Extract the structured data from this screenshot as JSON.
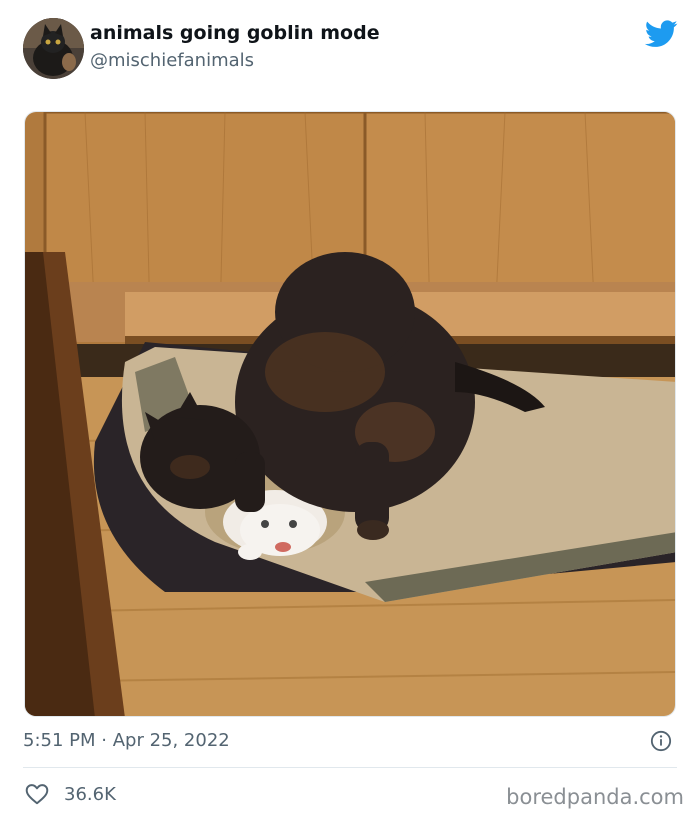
{
  "tweet": {
    "author": {
      "display_name": "animals going goblin mode",
      "handle": "@mischiefanimals",
      "avatar_icon": "cat-avatar-icon"
    },
    "brand_icon": "twitter-bird-icon",
    "brand_color": "#1d9bf0",
    "image": {
      "subject": "cat-photo"
    },
    "time": "5:51 PM",
    "separator": " · ",
    "date": "Apr 25, 2022",
    "info_icon": "info-icon",
    "likes": {
      "icon": "heart-icon",
      "count": "36.6K"
    }
  },
  "watermark": "boredpanda.com",
  "colors": {
    "text_primary": "#0f1419",
    "text_secondary": "#536471",
    "divider": "#e1e8ed"
  }
}
